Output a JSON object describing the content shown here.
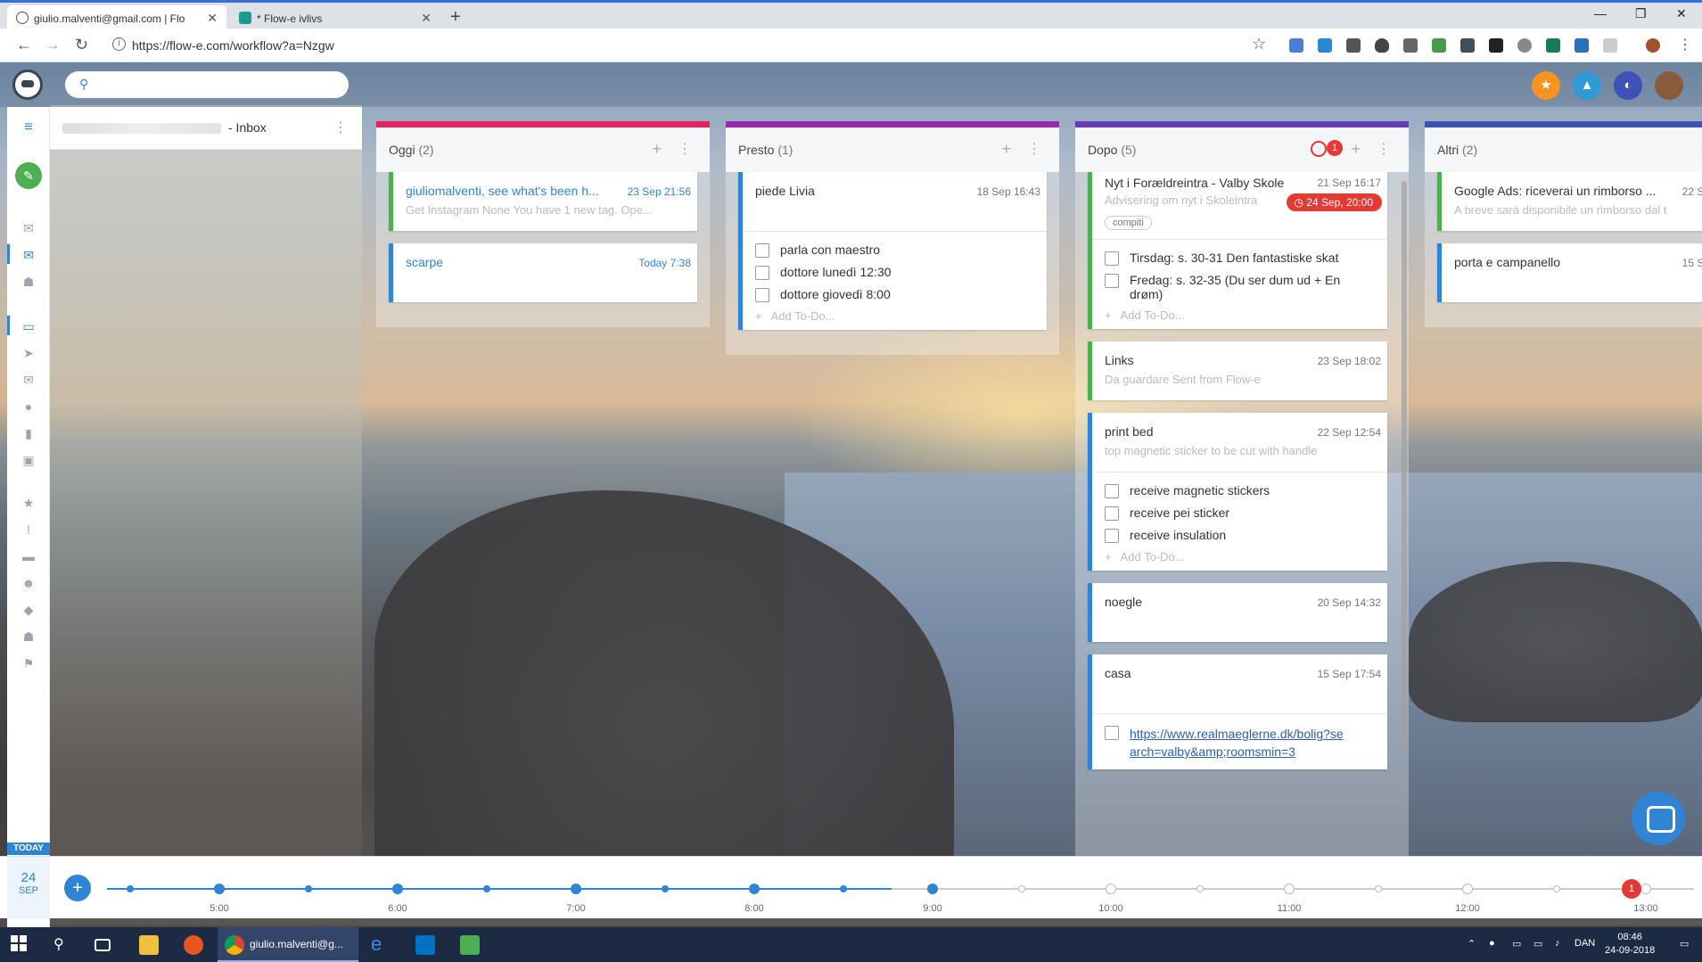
{
  "browser": {
    "tabs": [
      {
        "title": "giulio.malventi@gmail.com | Flo",
        "active": true
      },
      {
        "title": "* Flow-e ivlivs",
        "active": false
      }
    ],
    "url": "https://flow-e.com/workflow?a=Nzgw"
  },
  "app": {
    "search_placeholder": "",
    "inbox_title": "- Inbox"
  },
  "columns": [
    {
      "title": "Oggi",
      "count": "(2)",
      "color": "#e91e63",
      "cards": [
        {
          "title": "giuliomalventi, see what's been h...",
          "date": "23 Sep 21:56",
          "subtitle": "Get Instagram None You have 1 new tag. Ope...",
          "link": true,
          "accent": "green"
        },
        {
          "title": "scarpe",
          "date": "Today 7:38",
          "subtitle": "",
          "link": true,
          "accent": "blue"
        }
      ]
    },
    {
      "title": "Presto",
      "count": "(1)",
      "color": "#9c27b0",
      "cards": [
        {
          "title": "piede Livia",
          "date": "18 Sep 16:43",
          "accent": "blue",
          "todos": [
            "parla con maestro",
            "dottore lunedì 12:30",
            "dottore giovedì 8:00"
          ],
          "add_todo": "Add To-Do..."
        }
      ]
    },
    {
      "title": "Dopo",
      "count": "(5)",
      "color": "#673ab7",
      "alarm_count": "1",
      "cards": [
        {
          "title": "Nyt i Forældreintra - Valby Skole",
          "date": "21 Sep 16:17",
          "subtitle": "Advisering om nyt i Skoleintra",
          "reminder": "24 Sep, 20:00",
          "tag": "compiti",
          "accent": "green",
          "todos": [
            "Tirsdag: s. 30-31 Den fantastiske skat",
            "Fredag: s. 32-35 (Du ser dum ud + En drøm)"
          ],
          "add_todo": "Add To-Do..."
        },
        {
          "title": "Links",
          "date": "23 Sep 18:02",
          "subtitle": "Da guardare Sent from Flow-e",
          "accent": "green"
        },
        {
          "title": "print bed",
          "date": "22 Sep 12:54",
          "subtitle": "top magnetic sticker to be cut with handle",
          "accent": "blue",
          "todos": [
            "receive magnetic stickers",
            "receive pei sticker",
            "receive insulation"
          ],
          "add_todo": "Add To-Do..."
        },
        {
          "title": "noegle",
          "date": "20 Sep 14:32",
          "accent": "blue"
        },
        {
          "title": "casa",
          "date": "15 Sep 17:54",
          "accent": "blue",
          "link_todo": "https://www.realmaeglerne.dk/bolig?search=valby&amp;roomsmin=3"
        }
      ]
    },
    {
      "title": "Altri",
      "count": "(2)",
      "color": "#3f51b5",
      "cards": [
        {
          "title": "Google Ads: riceverai un rimborso ...",
          "date": "22 Se",
          "subtitle": "A breve sarà disponibile un rimborso dal t",
          "accent": "green"
        },
        {
          "title": "porta e campanello",
          "date": "15 Se",
          "accent": "blue"
        }
      ]
    }
  ],
  "timeline": {
    "today_label": "TODAY",
    "day": "24",
    "month": "SEP",
    "hours": [
      "5:00",
      "6:00",
      "7:00",
      "8:00",
      "9:00",
      "10:00",
      "11:00",
      "12:00",
      "13:00"
    ],
    "alert_count": "1"
  },
  "taskbar": {
    "chrome_label": "giulio.malventi@g...",
    "language": "DAN",
    "time": "08:46",
    "date": "24-09-2018"
  }
}
